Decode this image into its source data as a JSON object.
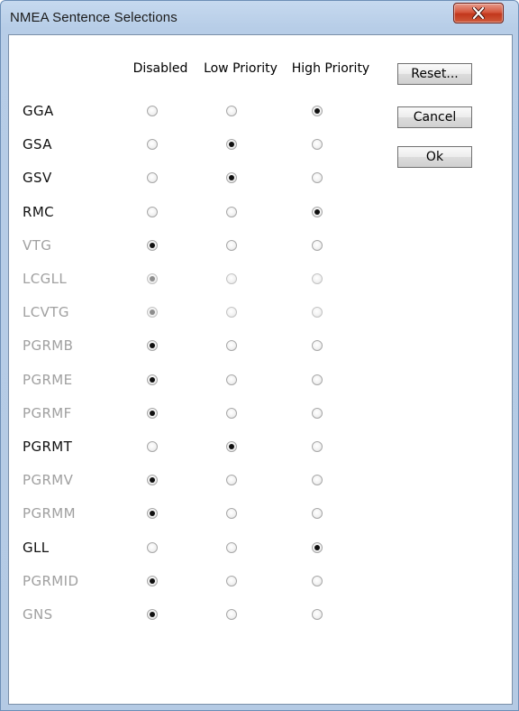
{
  "window": {
    "title": "NMEA Sentence Selections"
  },
  "headers": {
    "disabled": "Disabled",
    "low": "Low Priority",
    "high": "High Priority"
  },
  "buttons": {
    "reset": "Reset...",
    "cancel": "Cancel",
    "ok": "Ok"
  },
  "colors": {
    "enabled_text": "#111111",
    "disabled_text": "#a0a0a0"
  },
  "rows": [
    {
      "label": "GGA",
      "enabled": true,
      "selected": "high"
    },
    {
      "label": "GSA",
      "enabled": true,
      "selected": "low"
    },
    {
      "label": "GSV",
      "enabled": true,
      "selected": "low"
    },
    {
      "label": "RMC",
      "enabled": true,
      "selected": "high"
    },
    {
      "label": "VTG",
      "enabled": false,
      "selected": "disabled"
    },
    {
      "label": "LCGLL",
      "enabled": false,
      "selected": "disabled",
      "greyed_selection": true
    },
    {
      "label": "LCVTG",
      "enabled": false,
      "selected": "disabled",
      "greyed_selection": true
    },
    {
      "label": "PGRMB",
      "enabled": false,
      "selected": "disabled"
    },
    {
      "label": "PGRME",
      "enabled": false,
      "selected": "disabled"
    },
    {
      "label": "PGRMF",
      "enabled": false,
      "selected": "disabled"
    },
    {
      "label": "PGRMT",
      "enabled": true,
      "selected": "low"
    },
    {
      "label": "PGRMV",
      "enabled": false,
      "selected": "disabled"
    },
    {
      "label": "PGRMM",
      "enabled": false,
      "selected": "disabled"
    },
    {
      "label": "GLL",
      "enabled": true,
      "selected": "high"
    },
    {
      "label": "PGRMID",
      "enabled": false,
      "selected": "disabled"
    },
    {
      "label": "GNS",
      "enabled": false,
      "selected": "disabled"
    }
  ]
}
